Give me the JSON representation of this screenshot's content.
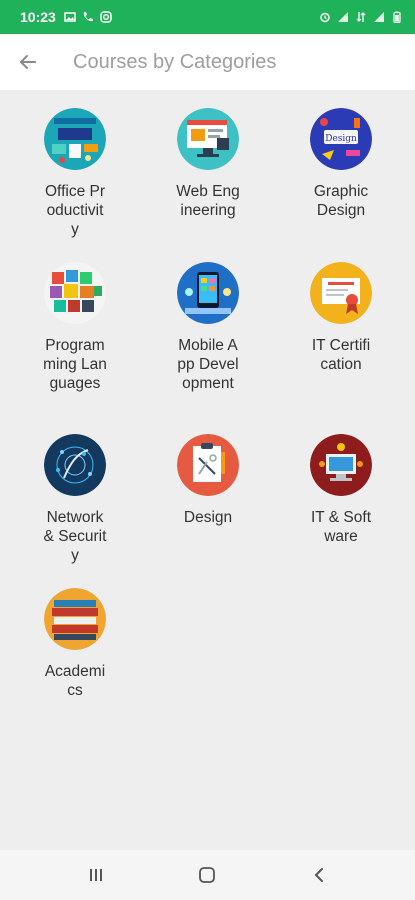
{
  "status": {
    "time": "10:23"
  },
  "app_bar": {
    "title": "Courses by Categories"
  },
  "categories": [
    {
      "label": "Office Productivity",
      "icon": "office-productivity-icon",
      "color": "#1ba7b8"
    },
    {
      "label": "Web Engineering",
      "icon": "web-engineering-icon",
      "color": "#3ec1c5"
    },
    {
      "label": "Graphic Design",
      "icon": "graphic-design-icon",
      "color": "#2b3bb5"
    },
    {
      "label": "Programming Languages",
      "icon": "programming-languages-icon",
      "color": "#e65b3b"
    },
    {
      "label": "Mobile App Development",
      "icon": "mobile-app-development-icon",
      "color": "#1f6fc7"
    },
    {
      "label": "IT Certification",
      "icon": "it-certification-icon",
      "color": "#f3b21c"
    },
    {
      "label": "Network & Security",
      "icon": "network-security-icon",
      "color": "#13395f"
    },
    {
      "label": "Design",
      "icon": "design-icon",
      "color": "#e65a41"
    },
    {
      "label": "IT & Software",
      "icon": "it-software-icon",
      "color": "#8e1c1c"
    },
    {
      "label": "Academics",
      "icon": "academics-icon",
      "color": "#f0a531"
    }
  ]
}
